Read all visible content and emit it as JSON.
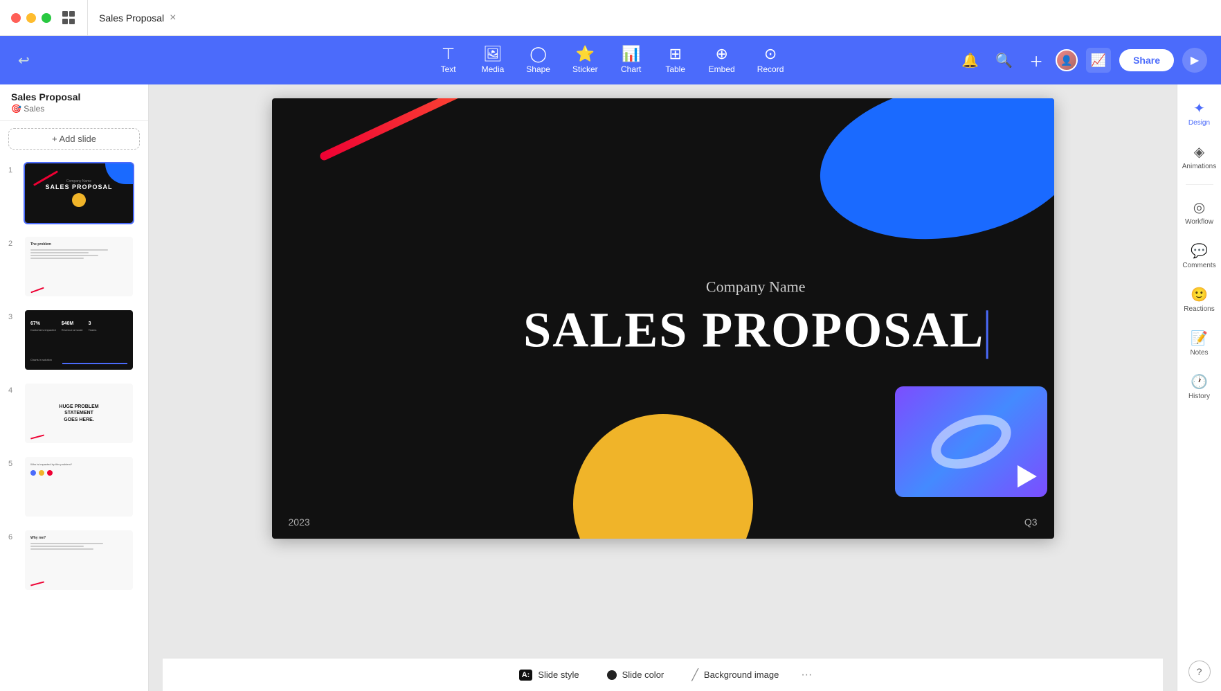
{
  "window": {
    "title": "Sales Proposal"
  },
  "breadcrumb": {
    "title": "Sales Proposal",
    "subtitle": "🎯 Sales"
  },
  "toolbar": {
    "tools": [
      {
        "id": "text",
        "label": "Text",
        "icon": "T"
      },
      {
        "id": "media",
        "label": "Media",
        "icon": "🖼"
      },
      {
        "id": "shape",
        "label": "Shape",
        "icon": "◯"
      },
      {
        "id": "sticker",
        "label": "Sticker",
        "icon": "⭐"
      },
      {
        "id": "chart",
        "label": "Chart",
        "icon": "📊"
      },
      {
        "id": "table",
        "label": "Table",
        "icon": "⊞"
      },
      {
        "id": "embed",
        "label": "Embed",
        "icon": "⊕"
      },
      {
        "id": "record",
        "label": "Record",
        "icon": "⊙"
      }
    ],
    "share_label": "Share",
    "undo_icon": "↩"
  },
  "slide": {
    "company_name": "Company Name",
    "title": "SALES PROPOSAL",
    "year": "2023",
    "quarter": "Q3"
  },
  "slides": [
    {
      "num": 1,
      "active": true
    },
    {
      "num": 2,
      "active": false
    },
    {
      "num": 3,
      "active": false
    },
    {
      "num": 4,
      "active": false
    },
    {
      "num": 5,
      "active": false
    },
    {
      "num": 6,
      "active": false
    }
  ],
  "add_slide": {
    "label": "+ Add slide"
  },
  "bottom_bar": {
    "slide_style": "Slide style",
    "slide_color": "Slide color",
    "background_image": "Background image"
  },
  "right_panel": {
    "design": "Design",
    "animations": "Animations",
    "workflow": "Workflow",
    "comments": "Comments",
    "reactions": "Reactions",
    "notes": "Notes",
    "history": "History"
  }
}
